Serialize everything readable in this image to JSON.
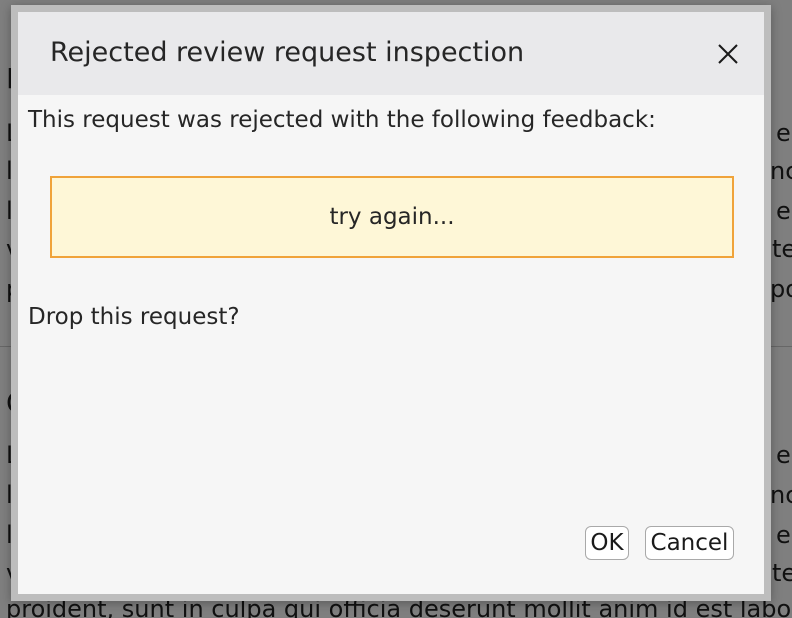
{
  "background": {
    "lines": [
      "L",
      "L",
      "l",
      "l",
      "v",
      "p",
      "C",
      "L",
      "l",
      "l",
      "v",
      "proident, sunt in culpa qui officia deserunt mollit anim id est labo"
    ],
    "right_fragments": [
      "e",
      "nc",
      "e",
      "te",
      "po",
      "e",
      "nc",
      "e",
      "te"
    ]
  },
  "dialog": {
    "title": "Rejected review request inspection",
    "close_icon": "close-icon",
    "message": "This request was rejected with the following feedback:",
    "feedback": "try again...",
    "question": "Drop this request?",
    "ok_label": "OK",
    "cancel_label": "Cancel"
  },
  "colors": {
    "feedback_background": "#fef7d7",
    "feedback_border": "#f0a33a",
    "header_background": "#e9e9eb",
    "dialog_background": "#f6f6f6"
  }
}
